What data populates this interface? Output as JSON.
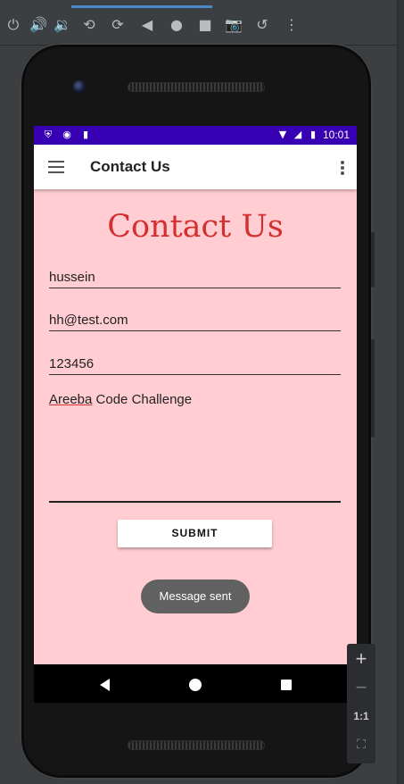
{
  "emulator_toolbar": {
    "icons": [
      "power-icon",
      "volume-up-icon",
      "volume-down-icon",
      "rotate-left-icon",
      "rotate-right-icon",
      "back-icon",
      "home-icon",
      "overview-icon",
      "camera-icon",
      "restore-snapshot-icon",
      "more-icon"
    ]
  },
  "status_bar": {
    "color": "#3700b3",
    "time": "10:01",
    "left_icons": [
      "shield-icon",
      "circle-icon",
      "sd-card-icon"
    ],
    "right_icons": [
      "wifi-icon",
      "signal-icon",
      "battery-icon"
    ]
  },
  "app_bar": {
    "title": "Contact Us",
    "menu_icon": "hamburger-icon",
    "overflow_icon": "overflow-menu-icon"
  },
  "form": {
    "heading": "Contact Us",
    "heading_color": "#d32f2f",
    "background": "#ffcdd2",
    "name_value": "hussein",
    "email_value": "hh@test.com",
    "phone_value": "123456",
    "message_word_underlined": "Areeba",
    "message_rest": " Code Challenge",
    "submit_label": "SUBMIT"
  },
  "toast": {
    "text": "Message sent"
  },
  "zoom_controls": {
    "plus": "+",
    "minus": "−",
    "ratio": "1:1"
  }
}
